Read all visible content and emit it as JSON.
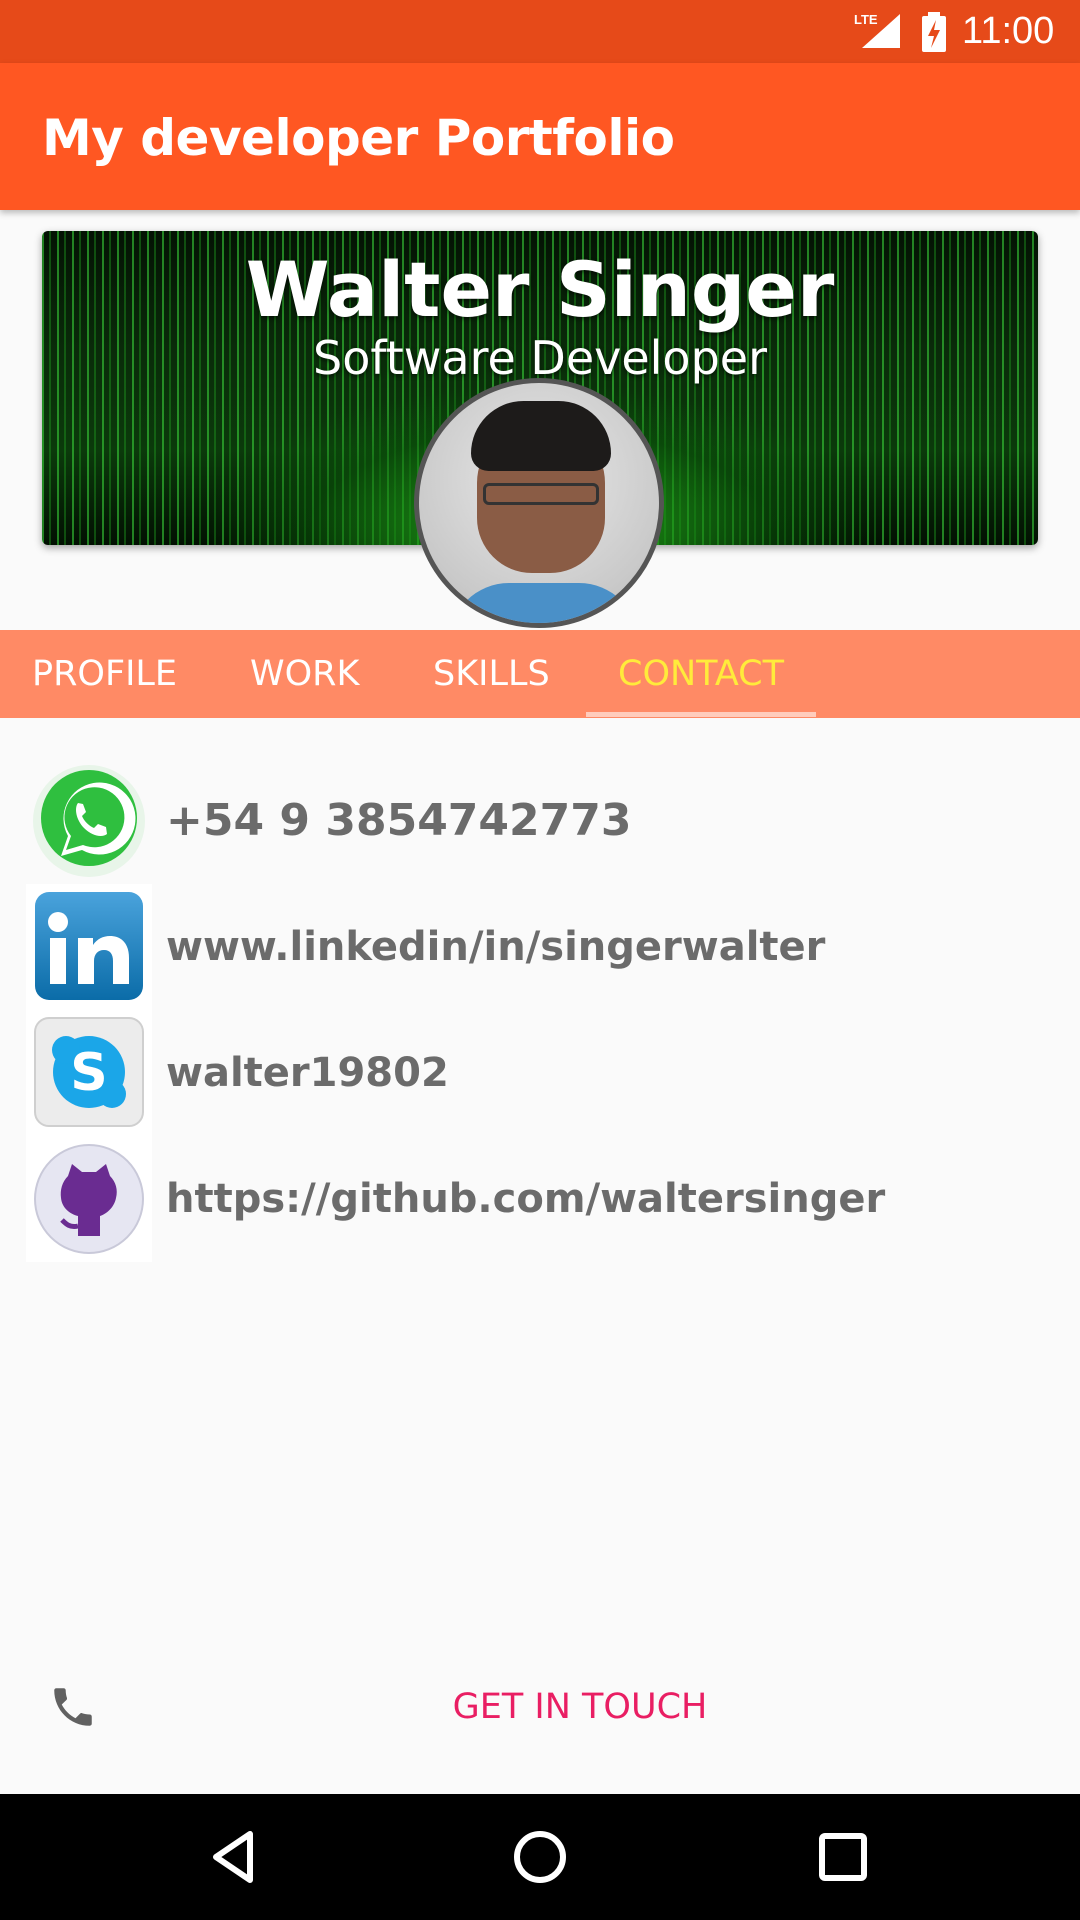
{
  "status_bar": {
    "network": "LTE",
    "time": "11:00"
  },
  "app_bar": {
    "title": "My developer Portfolio"
  },
  "header": {
    "name": "Walter Singer",
    "role": "Software Developer"
  },
  "tabs": [
    {
      "label": "PROFILE",
      "active": false
    },
    {
      "label": "WORK",
      "active": false
    },
    {
      "label": "SKILLS",
      "active": false
    },
    {
      "label": "CONTACT",
      "active": true
    }
  ],
  "contacts": [
    {
      "icon": "whatsapp-icon",
      "text": "+54 9 3854742773"
    },
    {
      "icon": "linkedin-icon",
      "text": "www.linkedin/in/singerwalter"
    },
    {
      "icon": "skype-icon",
      "text": "walter19802"
    },
    {
      "icon": "github-icon",
      "text": "https://github.com/waltersinger"
    }
  ],
  "action": {
    "icon": "phone-icon",
    "label": "GET IN TOUCH"
  },
  "colors": {
    "status_bar": "#e64a19",
    "app_bar": "#ff5722",
    "tabs_background": "#ff8a65",
    "tab_active": "#ffeb3b",
    "action_text": "#e91e63"
  }
}
